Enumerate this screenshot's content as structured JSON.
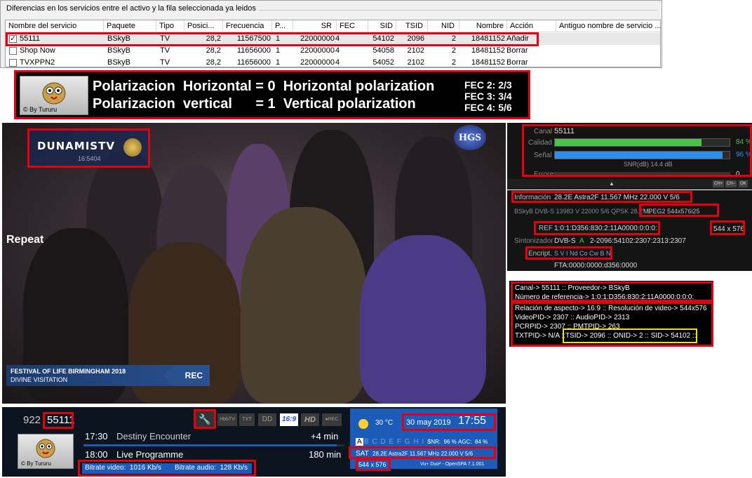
{
  "list_panel": {
    "caption": "Diferencias en los servicios entre el activo y la fila seleccionada ya leidos",
    "columns": [
      "Nombre del servicio",
      "Paquete",
      "Tipo",
      "Posici...",
      "Frecuencia",
      "P...",
      "SR",
      "FEC",
      "SID",
      "TSID",
      "NID",
      "Nombre",
      "Acción",
      "Antiguo nombre de servicio ..."
    ],
    "rows": [
      {
        "checked": true,
        "check_glyph": "✓",
        "name": "55111",
        "package": "BSkyB",
        "type": "TV",
        "position": "28,2",
        "frequency": "11567500",
        "pol": "1",
        "sr": "22000000",
        "fec": "4",
        "sid": "54102",
        "tsid": "2096",
        "nid": "2",
        "nombre": "18481152",
        "accion": "Añadir"
      },
      {
        "checked": false,
        "check_glyph": "",
        "name": "Shop Now",
        "package": "BSkyB",
        "type": "TV",
        "position": "28,2",
        "frequency": "11656000",
        "pol": "1",
        "sr": "22000000",
        "fec": "4",
        "sid": "54058",
        "tsid": "2102",
        "nid": "2",
        "nombre": "18481152",
        "accion": "Borrar"
      },
      {
        "checked": false,
        "check_glyph": "",
        "name": "TVXPPN2",
        "package": "BSkyB",
        "type": "TV",
        "position": "28,2",
        "frequency": "11656000",
        "pol": "1",
        "sr": "22000000",
        "fec": "4",
        "sid": "54052",
        "tsid": "2102",
        "nid": "2",
        "nombre": "18481152",
        "accion": "Borrar"
      }
    ]
  },
  "banner": {
    "by_text": "© By Tururu",
    "line1": "Polarizacion  Horizontal = 0  Horizontal polarization",
    "line2": "Polarizacion  vertical      = 1  Vertical polarization",
    "fec": [
      "FEC 2: 2/3",
      "FEC 3: 3/4",
      "FEC 4: 5/6"
    ]
  },
  "video": {
    "channel_logo": "DUNAMISTV",
    "logo_sub": "16:5404",
    "corner_logo": "HGS",
    "repeat": "Repeat",
    "caption_line1": "FESTIVAL OF LIFE BIRMINGHAM 2018",
    "caption_line2": "DIVINE VISITATION",
    "rec": "REC"
  },
  "signal_panel": {
    "canal_label": "Canal",
    "canal_value": "55111",
    "calidad_label": "Calidad",
    "calidad_pct": "84 %",
    "calidad_fill": 0.84,
    "senal_label": "Señal",
    "senal_pct": "96 %",
    "senal_fill": 0.96,
    "snr": "SNR(dB) 14.4 dB",
    "errores_label": "Errores",
    "errores_value": "0",
    "buttons": [
      "CH+",
      "CH−",
      "OK"
    ]
  },
  "info_panel": {
    "informacion_label": "Información",
    "informacion_value": "28.2E Astra2F 11.567 MHz 22.000 V 5/6",
    "bskyb_line": "BSkyB DVB-S 13983 V 22000 5/6 QPSK 28.2° E",
    "mpeg": "MPEG2 544x576i25",
    "ref_label": "REF",
    "ref_value": "1:0:1:D356:830:2:11A0000:0:0:0:",
    "res": "544 x 576",
    "sintonizador_label": "Sintonizador",
    "sintonizador_value": "DVB-S",
    "tuner_letter": "A",
    "sintonizador_ids": "2-2096:54102:2307:2313:2307",
    "encript_label": "Encript.",
    "encript_value": "S V I Nd Co Cw B N",
    "fta": "FTA:0000:0000:d356:0000"
  },
  "text_panel": {
    "line1": "Canal-> 55111 :: Proveedor-> BSkyB",
    "line2": "Número de referencia-> 1:0:1:D356:830:2:11A0000:0:0:0:",
    "line3": "Relación de aspecto-> 16:9 :: Resolución de video-> 544x576",
    "line4": "VideoPID-> 2307 :: AudioPID-> 2313",
    "line5": "PCRPID-> 2307 :: PMTPID-> 263",
    "line6a": "TXTPID-> N/A :: ",
    "line6b": "TSID-> 2096 :: ONID-> 2 :: SID-> 54102 ::"
  },
  "infobar": {
    "channel_number": "922",
    "channel_name": "55111",
    "icons": [
      "HbbTV",
      "TXT",
      "16:9",
      "HD",
      "●REC"
    ],
    "prog1_time": "17:30",
    "prog1_title": "Destiny Encounter",
    "prog1_remaining": "+4 min",
    "prog2_time": "18:00",
    "prog2_title": "Live Programme",
    "prog2_duration": "180 min",
    "bitrate_video": "Bitrate video:  1016 Kb/s",
    "bitrate_audio": "Bitrate audio:  128 Kb/s",
    "by_text": "© By Tururu",
    "temperature": "30 °C",
    "date": "30 may 2019",
    "time": "17:55",
    "caids_active": "A",
    "caids_rest": "B C D E F G H I J",
    "snr": "SNR:  96 %",
    "agc": "AGC:  84 %",
    "sat_label": "SAT",
    "sat_value": "28.2E Astra2F 11.567 MHz 22.000 V 5/6",
    "res": "544 x 576",
    "box_info": "Vu+ Duo² - OpenSPA 7.1.001",
    "colors": {
      "blue": "#1c5bb8",
      "red_box": "#e3000f",
      "yellow_box": "#f3e000",
      "quality_bar": "#4cc24c",
      "signal_bar": "#2f8fe8"
    }
  }
}
